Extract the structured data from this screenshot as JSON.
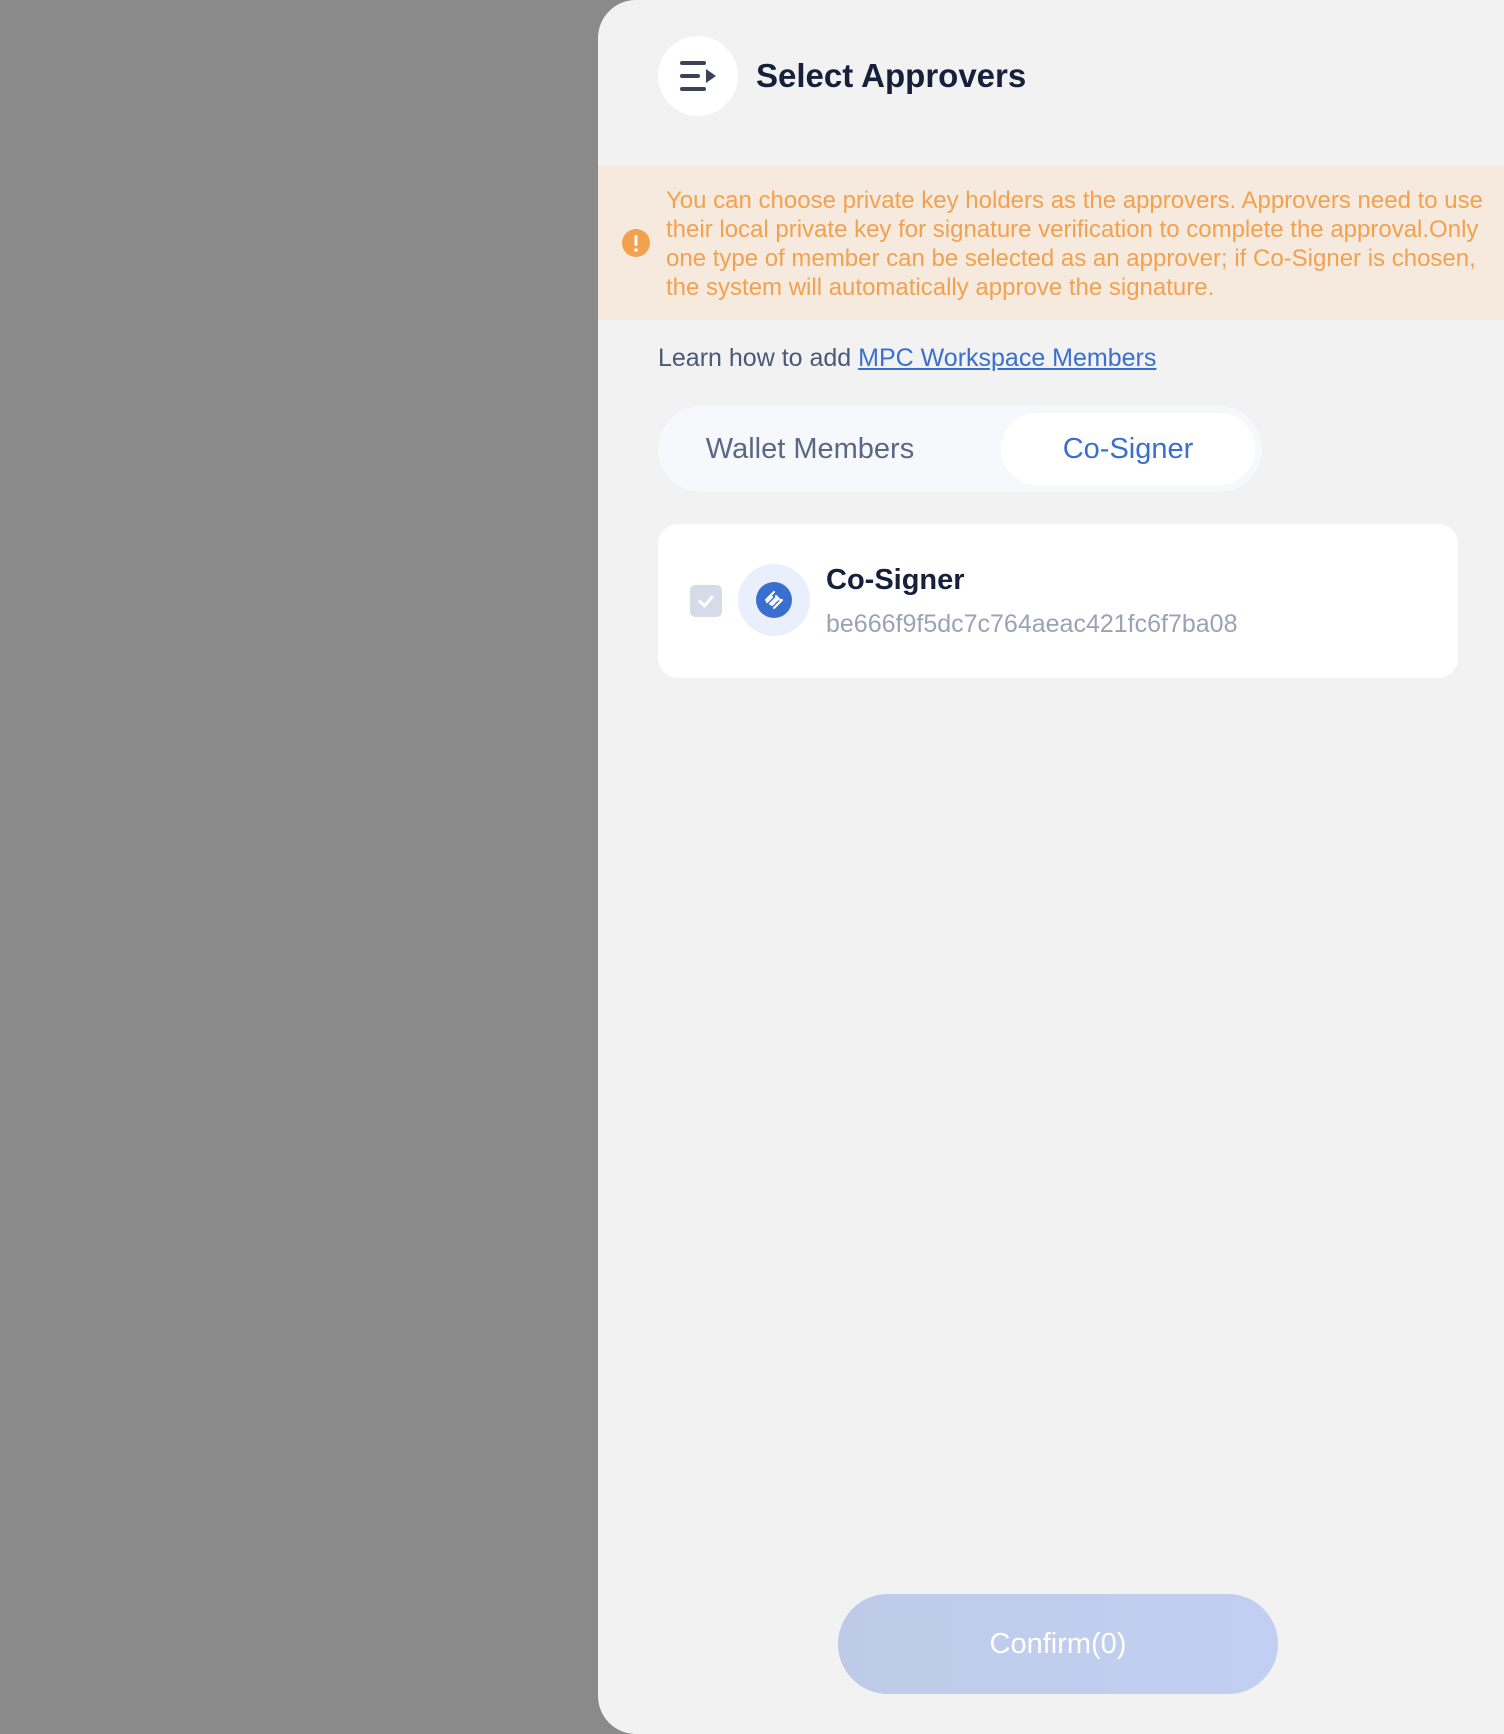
{
  "drawer": {
    "title": "Select Approvers",
    "notice": "You can choose private key holders as the approvers. Approvers need to use their local private key for signature verification to complete the approval.Only one type of member can be selected as an approver; if Co-Signer is chosen, the system will automatically approve the signature.",
    "learn_prefix": "Learn how to add ",
    "learn_link": "MPC Workspace Members",
    "tabs": [
      {
        "label": "Wallet Members",
        "active": false
      },
      {
        "label": "Co-Signer",
        "active": true
      }
    ],
    "member": {
      "name": "Co-Signer",
      "id": "be666f9f5dc7c764aeac421fc6f7ba08",
      "checked": true
    },
    "confirm_label": "Confirm(0)"
  },
  "colors": {
    "accent": "#3a6fd0",
    "warning": "#f2a24e",
    "notice_bg": "#f6e9de",
    "overlay": "#8a8a8a"
  },
  "icons": {
    "collapse": "collapse-menu-icon",
    "warning": "warning-icon",
    "checkbox": "check-icon",
    "avatar": "cosigner-link-icon"
  }
}
